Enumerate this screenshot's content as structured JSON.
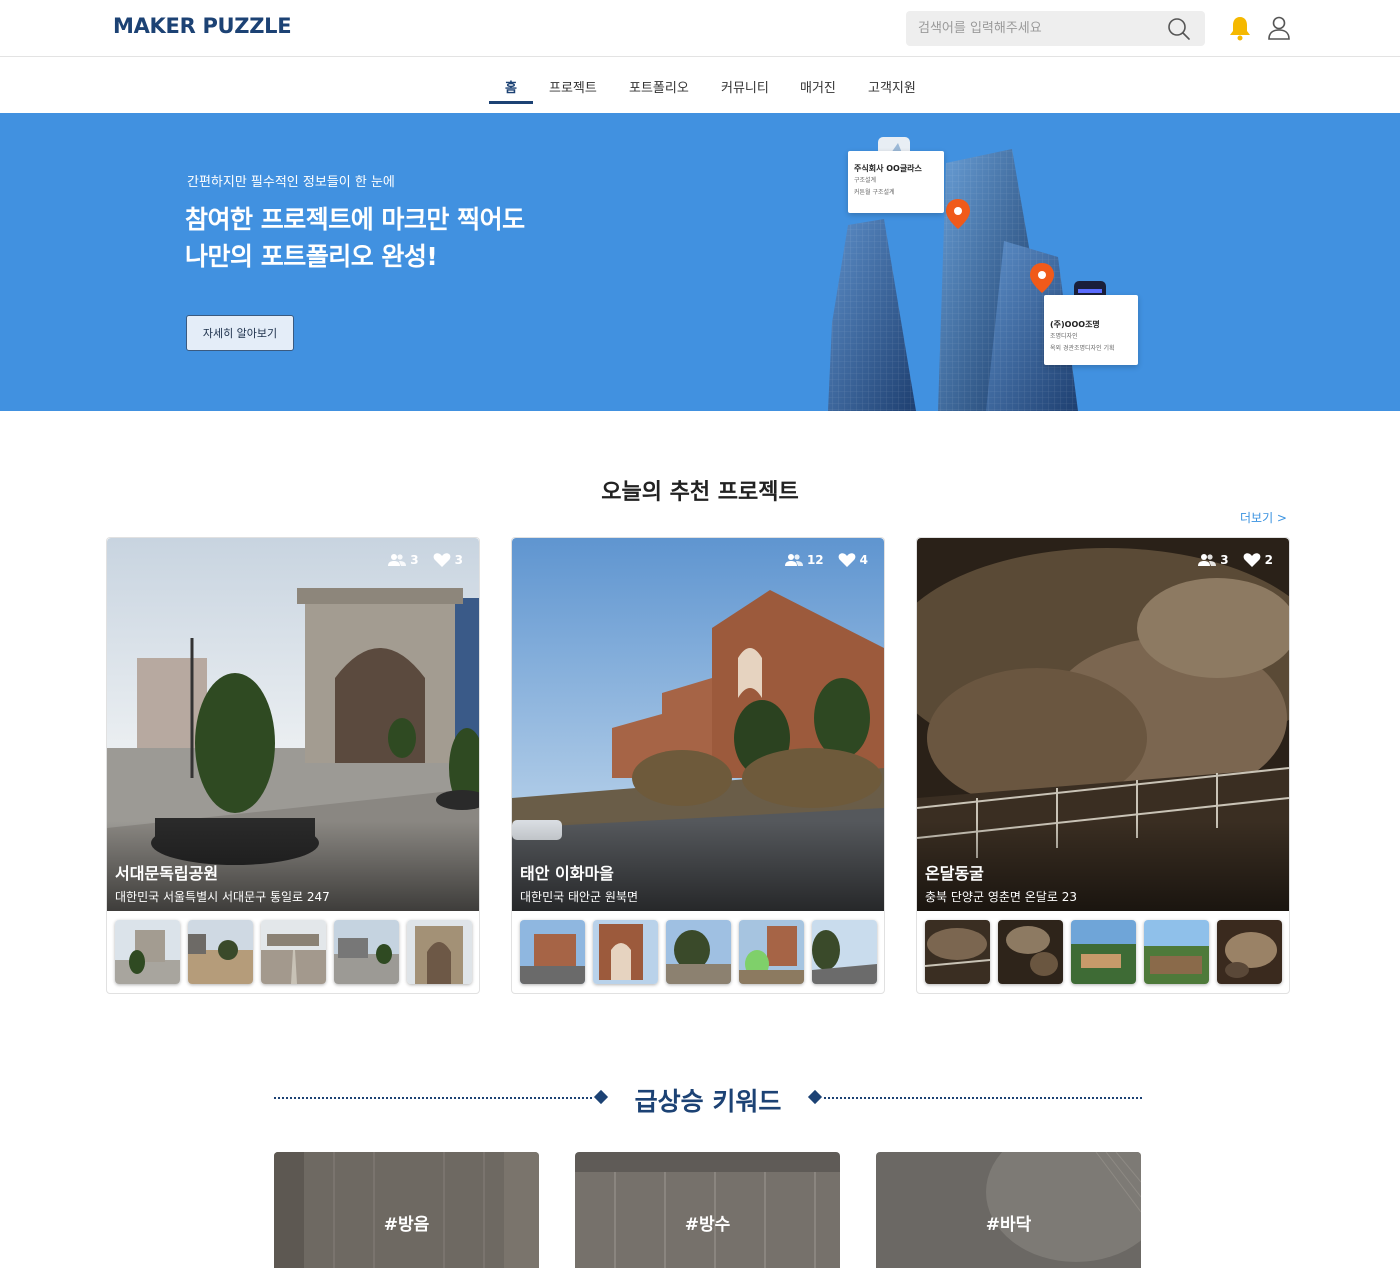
{
  "header": {
    "logo": "MAKER PUZZLE",
    "search_placeholder": "검색어를 입력해주세요",
    "icons": [
      "search-icon",
      "bell-icon",
      "user-icon"
    ]
  },
  "nav": {
    "items": [
      {
        "label": "홈",
        "active": true
      },
      {
        "label": "프로젝트"
      },
      {
        "label": "포트폴리오"
      },
      {
        "label": "커뮤니티"
      },
      {
        "label": "매거진"
      },
      {
        "label": "고객지원"
      }
    ]
  },
  "banner": {
    "subtitle": "간편하지만 필수적인 정보들이 한 눈에",
    "title_line1": "참여한 프로젝트에 마크만 찍어도",
    "title_line2": "나만의 포트폴리오 완성!",
    "button": "자세히 알아보기",
    "card1": {
      "title": "주식회사 OO글라스",
      "line1": "구조설계",
      "line2": "커튼월 구조설계"
    },
    "card2": {
      "title": "(주)OOO조명",
      "line1": "조명디자인",
      "line2": "옥외 경관조명디자인 기획"
    },
    "color": "#4191e0"
  },
  "recommended": {
    "title": "오늘의 추천 프로젝트",
    "more": "더보기 >",
    "cards": [
      {
        "name": "서대문독립공원",
        "address": "대한민국 서울특별시 서대문구 통일로 247",
        "participants": "3",
        "likes": "3"
      },
      {
        "name": "태안 이화마을",
        "address": "대한민국 태안군 원북면",
        "participants": "12",
        "likes": "4"
      },
      {
        "name": "온달동굴",
        "address": "충북 단양군 영춘면 온달로 23",
        "participants": "3",
        "likes": "2"
      }
    ]
  },
  "keywords": {
    "title": "급상승 키워드",
    "items": [
      "#방음",
      "#방수",
      "#바닥"
    ]
  },
  "colors": {
    "brand": "#1c4274",
    "accent": "#3b93e0"
  }
}
